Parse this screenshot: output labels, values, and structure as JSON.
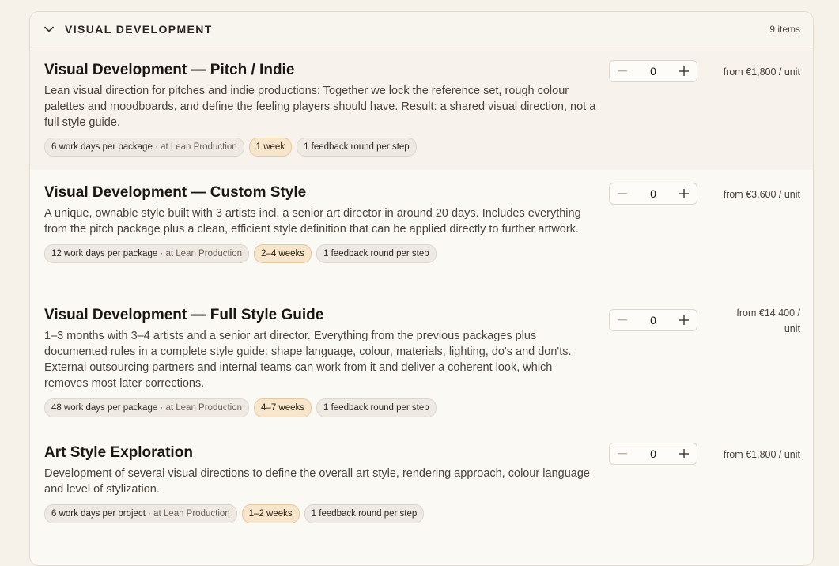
{
  "section": {
    "title": "VISUAL DEVELOPMENT",
    "count": "9 items",
    "icon": "chevron-down-icon"
  },
  "items": [
    {
      "title": "Visual Development — Pitch / Indie",
      "description": "Lean visual direction for pitches and indie productions: Together we lock the reference set, rough colour palettes and moodboards, and define the feeling players should have. Result: a shared visual direction, not a full style guide.",
      "days": "6 work days per package",
      "days_suffix": "· at Lean Production",
      "duration": "1 week",
      "feedback": "1 feedback round per step",
      "quantity": "0",
      "price": "from €1,800 / unit"
    },
    {
      "title": "Visual Development — Custom Style",
      "description": "A unique, ownable style built with 3 artists incl. a senior art director in around 20 days. Includes everything from the pitch package plus a clean, efficient style definition that can be applied directly to further artwork.",
      "days": "12 work days per package",
      "days_suffix": "· at Lean Production",
      "duration": "2–4 weeks",
      "feedback": "1 feedback round per step",
      "quantity": "0",
      "price": "from €3,600 / unit"
    },
    {
      "title": "Visual Development — Full Style Guide",
      "description": "1–3 months with 3–4 artists and a senior art director. Everything from the previous packages plus documented rules in a complete style guide: shape language, colour, materials, lighting, do's and don'ts. External outsourcing partners and internal teams can work from it and deliver a coherent look, which removes most later corrections.",
      "days": "48 work days per package",
      "days_suffix": "· at Lean Production",
      "duration": "4–7 weeks",
      "feedback": "1 feedback round per step",
      "quantity": "0",
      "price": "from €14,400 / unit"
    },
    {
      "title": "Art Style Exploration",
      "description": "Development of several visual directions to define the overall art style, rendering approach, colour language and level of stylization.",
      "days": "6 work days per project",
      "days_suffix": "· at Lean Production",
      "duration": "1–2 weeks",
      "feedback": "1 feedback round per step",
      "quantity": "0",
      "price": "from €1,800 / unit"
    }
  ],
  "icons": {
    "minus": "minus-icon",
    "plus": "plus-icon"
  },
  "colors": {
    "duration_badge": "#f7e6cb",
    "background": "#f6f2ea"
  }
}
